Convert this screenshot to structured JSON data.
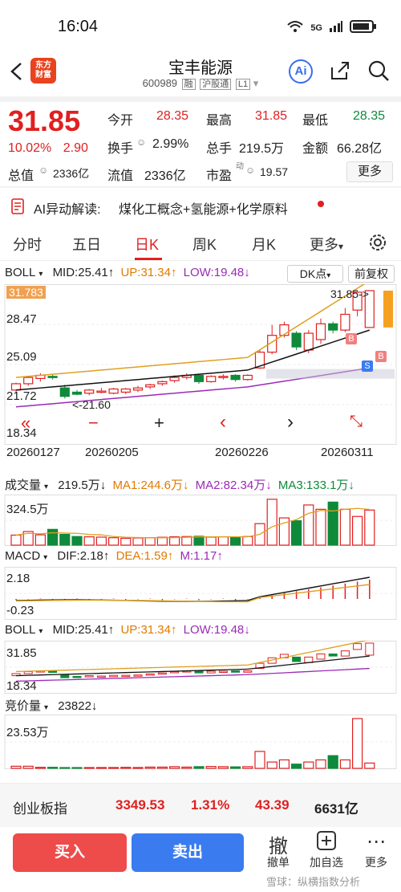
{
  "status_bar": {
    "time": "16:04",
    "network": "5G",
    "wifi": "wifi-icon",
    "battery": "battery-icon"
  },
  "header": {
    "logo": "东方\n财富",
    "title": "宝丰能源",
    "code": "600989",
    "tags": [
      "融",
      "沪股通",
      "L1"
    ],
    "ai_label": "Ai"
  },
  "quote": {
    "price": "31.85",
    "change_pct": "10.02%",
    "change": "2.90",
    "open_label": "今开",
    "open": "28.35",
    "high_label": "最高",
    "high": "31.85",
    "low_label": "最低",
    "low": "28.35",
    "turnover_label": "换手",
    "turnover": "2.99%",
    "volume_label": "总手",
    "volume": "219.5万",
    "amount_label": "金额",
    "amount": "66.28亿",
    "mktcap_label": "总值",
    "mktcap": "2336亿",
    "float_label": "流值",
    "float": "2336亿",
    "pe_label": "市盈",
    "pe_sup": "动",
    "pe": "19.57",
    "more_label": "更多"
  },
  "ai_banner": {
    "label": "AI异动解读:",
    "text": "煤化工概念+氢能源+化学原料"
  },
  "tabs": [
    "分时",
    "五日",
    "日K",
    "周K",
    "月K",
    "更多"
  ],
  "active_tab": "日K",
  "kline": {
    "boll_label": "BOLL",
    "mid": "MID:25.41↑",
    "up": "UP:31.34↑",
    "low": "LOW:19.48↓",
    "dk_label": "DK点",
    "adj_label": "前复权",
    "y_top": "31.783",
    "y_mid1": "28.47",
    "y_mid2": "25.09",
    "y_mid3": "21.72",
    "y_bot": "18.34",
    "last_label": "31.85->",
    "low_mark": "<-21.60",
    "dates": [
      "20260127",
      "20260205",
      "20260226",
      "20260311"
    ],
    "badges": {
      "b": "B",
      "s": "S"
    },
    "nav": [
      "«",
      "−",
      "+",
      "‹",
      "›",
      "⤡"
    ]
  },
  "volume_panel": {
    "label": "成交量",
    "vol": "219.5万↓",
    "ma1": "MA1:244.6万↓",
    "ma2": "MA2:82.34万↓",
    "ma3": "MA3:133.1万↓",
    "y_top": "324.5万"
  },
  "macd_panel": {
    "label": "MACD",
    "dif": "DIF:2.18↑",
    "dea": "DEA:1.59↑",
    "m": "M:1.17↑",
    "y_top": "2.18",
    "y_bot": "-0.23"
  },
  "boll_panel": {
    "label": "BOLL",
    "mid": "MID:25.41↑",
    "up": "UP:31.34↑",
    "low": "LOW:19.48↓",
    "y_top": "31.85",
    "y_bot": "18.34"
  },
  "auction_panel": {
    "label": "竞价量",
    "value": "23822↓",
    "y_top": "23.53万"
  },
  "index_bar": {
    "name": "创业板指",
    "value": "3349.53",
    "pct": "1.31%",
    "change": "43.39",
    "amount": "6631亿"
  },
  "bottom_actions": {
    "buy": "买入",
    "sell": "卖出",
    "cancel": "撤单",
    "add": "加自选",
    "more": "更多",
    "cancel_icon": "撤"
  },
  "watermark": "雪球：纵横指数分析",
  "colors": {
    "up": "#e02020",
    "down": "#0e8a3a",
    "mid": "#e0a020",
    "low": "#9b2bb5",
    "buy": "#ee4b4b",
    "sell": "#3a7bef"
  },
  "chart_data": [
    {
      "type": "candlestick",
      "title": "日K",
      "ylim": [
        18.34,
        31.85
      ],
      "x": [
        "20260127",
        "20260205",
        "20260226",
        "20260311"
      ],
      "series": [
        {
          "name": "MID",
          "last": 25.41
        },
        {
          "name": "UP",
          "last": 31.34
        },
        {
          "name": "LOW",
          "last": 19.48
        }
      ],
      "candles": [
        [
          22.4,
          23.0,
          22.1,
          23.1
        ],
        [
          23.0,
          23.6,
          22.8,
          23.7
        ],
        [
          23.5,
          23.8,
          23.2,
          24.0
        ],
        [
          23.7,
          23.6,
          23.4,
          23.9
        ],
        [
          22.6,
          21.8,
          21.6,
          22.9
        ],
        [
          22.2,
          22.0,
          21.9,
          22.4
        ],
        [
          22.1,
          22.4,
          21.9,
          22.5
        ],
        [
          22.3,
          22.3,
          22.1,
          22.6
        ],
        [
          22.1,
          22.5,
          22.0,
          22.6
        ],
        [
          22.2,
          22.5,
          22.0,
          22.6
        ],
        [
          22.4,
          22.6,
          22.2,
          22.8
        ],
        [
          22.7,
          22.9,
          22.5,
          23.0
        ],
        [
          23.0,
          23.2,
          22.8,
          23.3
        ],
        [
          23.3,
          23.6,
          23.1,
          23.8
        ],
        [
          23.6,
          23.8,
          23.4,
          24.0
        ],
        [
          23.8,
          23.2,
          23.0,
          23.9
        ],
        [
          23.2,
          23.7,
          23.1,
          23.8
        ],
        [
          23.6,
          23.7,
          23.4,
          23.9
        ],
        [
          23.8,
          23.4,
          23.2,
          23.9
        ],
        [
          23.4,
          23.8,
          23.3,
          23.9
        ],
        [
          24.5,
          26.0,
          24.4,
          26.2
        ],
        [
          26.0,
          27.6,
          25.8,
          28.6
        ],
        [
          27.6,
          28.6,
          27.4,
          28.9
        ],
        [
          27.8,
          26.5,
          26.2,
          28.0
        ],
        [
          26.2,
          27.8,
          25.9,
          28.1
        ],
        [
          27.2,
          28.7,
          26.8,
          29.2
        ],
        [
          28.7,
          28.1,
          27.8,
          28.9
        ],
        [
          28.1,
          29.6,
          27.9,
          30.2
        ],
        [
          30.0,
          31.7,
          29.4,
          31.9
        ],
        [
          28.35,
          31.85,
          28.35,
          31.85
        ]
      ]
    },
    {
      "type": "bar",
      "title": "成交量",
      "values": [
        70,
        95,
        72,
        110,
        75,
        60,
        58,
        56,
        52,
        48,
        50,
        52,
        55,
        58,
        60,
        62,
        56,
        58,
        54,
        60,
        150,
        320,
        190,
        170,
        280,
        250,
        300,
        250,
        200,
        244.6
      ],
      "ylim": [
        0,
        324.5
      ]
    },
    {
      "type": "bar",
      "title": "竞价量",
      "values": [
        1,
        1,
        0.5,
        0.5,
        0.3,
        0.3,
        0.3,
        0.4,
        0.4,
        0.5,
        0.4,
        0.6,
        0.6,
        0.8,
        0.6,
        0.8,
        0.9,
        0.8,
        0.7,
        0.8,
        8,
        3,
        4,
        2,
        3,
        4,
        6,
        4,
        23.53,
        2.5
      ],
      "ylim": [
        0,
        23.53
      ]
    }
  ]
}
